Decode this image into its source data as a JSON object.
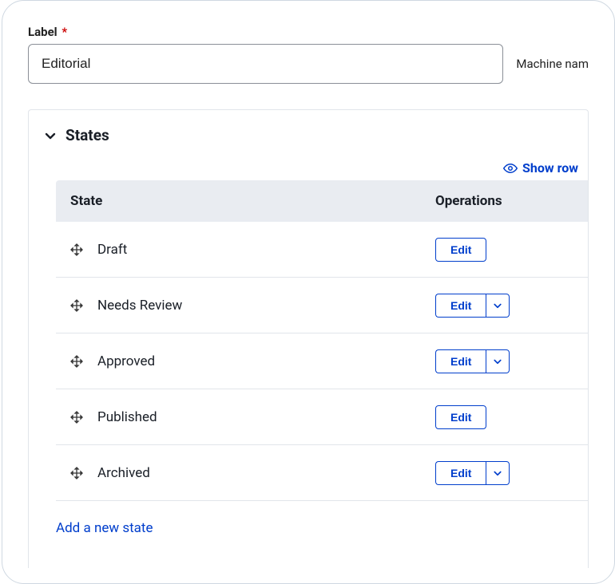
{
  "label": {
    "title": "Label",
    "required_marker": "*",
    "value": "Editorial",
    "machine_name_text": "Machine nam"
  },
  "states": {
    "title": "States",
    "show_row_link": "Show row",
    "columns": {
      "state": "State",
      "operations": "Operations"
    },
    "rows": [
      {
        "name": "Draft",
        "edit_label": "Edit",
        "has_dropdown": false
      },
      {
        "name": "Needs Review",
        "edit_label": "Edit",
        "has_dropdown": true
      },
      {
        "name": "Approved",
        "edit_label": "Edit",
        "has_dropdown": true
      },
      {
        "name": "Published",
        "edit_label": "Edit",
        "has_dropdown": false
      },
      {
        "name": "Archived",
        "edit_label": "Edit",
        "has_dropdown": true
      }
    ],
    "add_new": "Add a new state"
  },
  "colors": {
    "accent": "#003ecc",
    "border": "#e1e5ea",
    "header_bg": "#e9ecf1",
    "text": "#1a1f27",
    "required": "#c00"
  }
}
